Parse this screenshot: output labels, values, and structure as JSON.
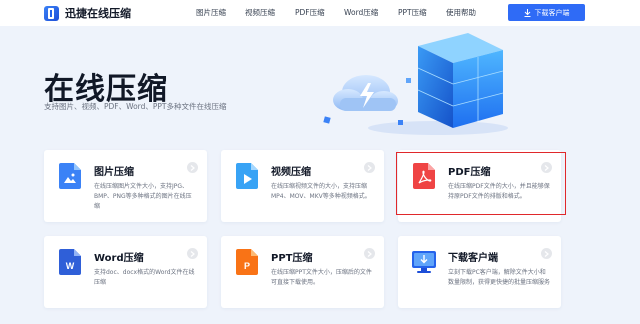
{
  "header": {
    "brand": "迅捷在线压缩",
    "nav": [
      "图片压缩",
      "视频压缩",
      "PDF压缩",
      "Word压缩",
      "PPT压缩",
      "使用帮助"
    ],
    "download_button": "下载客户端"
  },
  "hero": {
    "title": "在线压缩",
    "subtitle": "支持图片、视频、PDF、Word、PPT多种文件在线压缩"
  },
  "cards": [
    {
      "title": "图片压缩",
      "desc": "在线压缩图片文件大小，支持JPG、BMP、PNG等多种格式的图片在线压缩",
      "icon": "image-file-icon",
      "color": "#3b82f6"
    },
    {
      "title": "视频压缩",
      "desc": "在线压缩视频文件的大小，支持压缩MP4、MOV、MKV等多种视频格式。",
      "icon": "video-file-icon",
      "color": "#38a3f5"
    },
    {
      "title": "PDF压缩",
      "desc": "在线压缩PDF文件的大小，并且能够保持原PDF文件的排版和格式。",
      "icon": "pdf-file-icon",
      "color": "#ef4444"
    },
    {
      "title": "Word压缩",
      "desc": "支持doc、docx格式的Word文件在线压缩",
      "icon": "word-file-icon",
      "color": "#2f5fd8"
    },
    {
      "title": "PPT压缩",
      "desc": "在线压缩PPT文件大小，压缩后的文件可直接下载使用。",
      "icon": "ppt-file-icon",
      "color": "#f97316"
    },
    {
      "title": "下载客户端",
      "desc": "立刻下载PC客户端，解除文件大小和数量限制，获得更快捷的批量压缩服务",
      "icon": "desktop-download-icon",
      "color": "#2563eb"
    }
  ],
  "colors": {
    "accent": "#2f6bf6",
    "highlight_border": "#e0282b",
    "background": "#eef3fb"
  }
}
